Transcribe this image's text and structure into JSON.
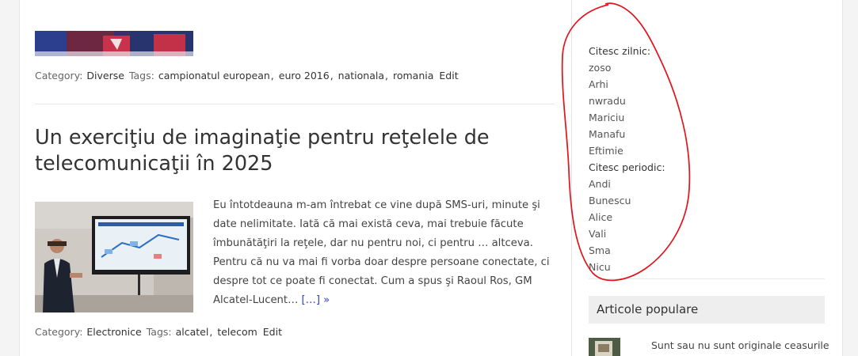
{
  "posts": {
    "prev": {
      "category_label": "Category:",
      "category": "Diverse",
      "tags_label": "Tags:",
      "tags": [
        "campionatul european",
        "euro 2016",
        "nationala",
        "romania"
      ],
      "edit": "Edit"
    },
    "current": {
      "title": "Un exerciţiu de imaginaţie pentru reţelele de telecomunicaţii în 2025",
      "excerpt": "Eu întotdeauna m-am întrebat ce vine după SMS-uri, minute şi date nelimitate. Iată că mai există ceva, mai trebuie făcute îmbunătăţiri la reţele, dar nu pentru noi, ci pentru … altceva. Pentru că nu va mai fi vorba doar despre persoane conectate, ci despre tot ce poate fi conectat. Cum a spus şi Raoul Ros, GM Alcatel-Lucent…",
      "read_more": "[…] »",
      "category_label": "Category:",
      "category": "Electronice",
      "tags_label": "Tags:",
      "tags": [
        "alcatel",
        "telecom"
      ],
      "edit": "Edit"
    }
  },
  "sidebar": {
    "daily_heading": "Citesc zilnic:",
    "daily": [
      "zoso",
      "Arhi",
      "nwradu",
      "Mariciu",
      "Manafu",
      "Eftimie"
    ],
    "periodic_heading": "Citesc periodic:",
    "periodic": [
      "Andi",
      "Bunescu",
      "Alice",
      "Vali",
      "Sma",
      "Nicu"
    ],
    "popular_title": "Articole populare",
    "popular_first": "Sunt sau nu sunt originale ceasurile"
  },
  "colors": {
    "link_accent": "#2a3fbf",
    "annotation_red": "#e3121b",
    "widget_header_bg": "#eeeeee"
  }
}
